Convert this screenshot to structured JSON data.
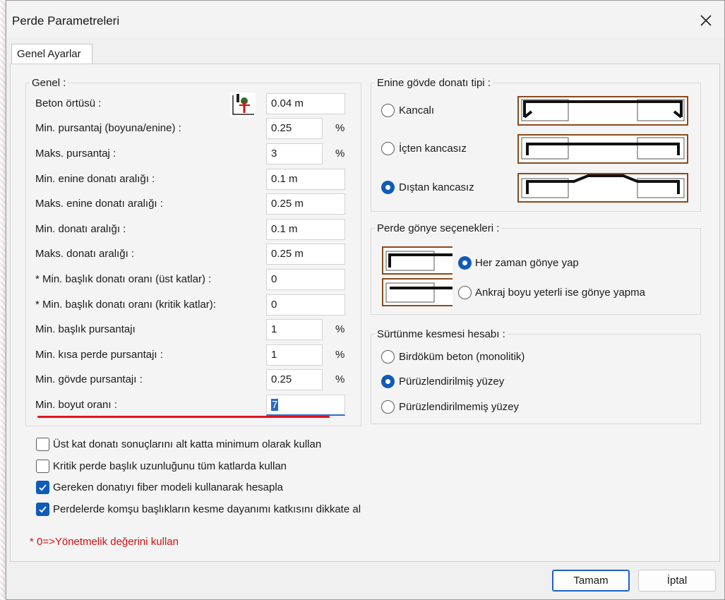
{
  "window": {
    "title": "Perde Parametreleri"
  },
  "tab": {
    "label": "Genel Ayarlar"
  },
  "genel": {
    "title": "Genel :",
    "rows": [
      {
        "label": "Beton örtüsü :",
        "value": "0.04 m",
        "unit": ""
      },
      {
        "label": "Min. pursantaj (boyuna/enine) :",
        "value": "0.25",
        "unit": "%"
      },
      {
        "label": "Maks. pursantaj :",
        "value": "3",
        "unit": "%"
      },
      {
        "label": "Min. enine donatı aralığı :",
        "value": "0.1 m",
        "unit": ""
      },
      {
        "label": "Maks. enine donatı aralığı :",
        "value": "0.25 m",
        "unit": ""
      },
      {
        "label": "Min. donatı aralığı :",
        "value": "0.1 m",
        "unit": ""
      },
      {
        "label": "Maks. donatı aralığı :",
        "value": "0.25 m",
        "unit": ""
      },
      {
        "label": "* Min. başlık donatı oranı (üst katlar) :",
        "value": "0",
        "unit": ""
      },
      {
        "label": "* Min. başlık donatı oranı (kritik katlar):",
        "value": "0",
        "unit": ""
      },
      {
        "label": "Min. başlık pursantajı",
        "value": "1",
        "unit": "%"
      },
      {
        "label": "Min. kısa perde pursantajı :",
        "value": "1",
        "unit": "%"
      },
      {
        "label": "Min. gövde pursantajı :",
        "value": "0.25",
        "unit": "%"
      },
      {
        "label": "Min. boyut oranı :",
        "value": "7",
        "unit": ""
      }
    ]
  },
  "enine": {
    "title": "Enine gövde donatı tipi :",
    "options": [
      {
        "label": "Kancalı",
        "selected": false
      },
      {
        "label": "İçten kancasız",
        "selected": false
      },
      {
        "label": "Dıştan kancasız",
        "selected": true
      }
    ]
  },
  "gonye": {
    "title": "Perde gönye seçenekleri :",
    "options": [
      {
        "label": "Her zaman gönye yap",
        "selected": true
      },
      {
        "label": "Ankraj boyu yeterli ise gönye yapma",
        "selected": false
      }
    ]
  },
  "surtunme": {
    "title": "Sürtünme kesmesi hesabı :",
    "options": [
      {
        "label": "Birdöküm beton (monolitik)",
        "selected": false
      },
      {
        "label": "Pürüzlendirilmiş yüzey",
        "selected": true
      },
      {
        "label": "Pürüzlendirilmemiş yüzey",
        "selected": false
      }
    ]
  },
  "checks": [
    {
      "label": "Üst kat donatı sonuçlarını alt katta minimum olarak kullan",
      "checked": false
    },
    {
      "label": "Kritik perde başlık uzunluğunu tüm katlarda kullan",
      "checked": false
    },
    {
      "label": "Gereken donatıyı fiber modeli kullanarak hesapla",
      "checked": true
    },
    {
      "label": "Perdelerde komşu başlıkların kesme dayanımı katkısını dikkate al",
      "checked": true
    }
  ],
  "note": "* 0=>Yönetmelik değerini kullan",
  "buttons": {
    "ok": "Tamam",
    "cancel": "İptal"
  },
  "colors": {
    "accent": "#0f5bb8",
    "note": "#d01010",
    "rebar_frame": "#8b4a1c"
  }
}
